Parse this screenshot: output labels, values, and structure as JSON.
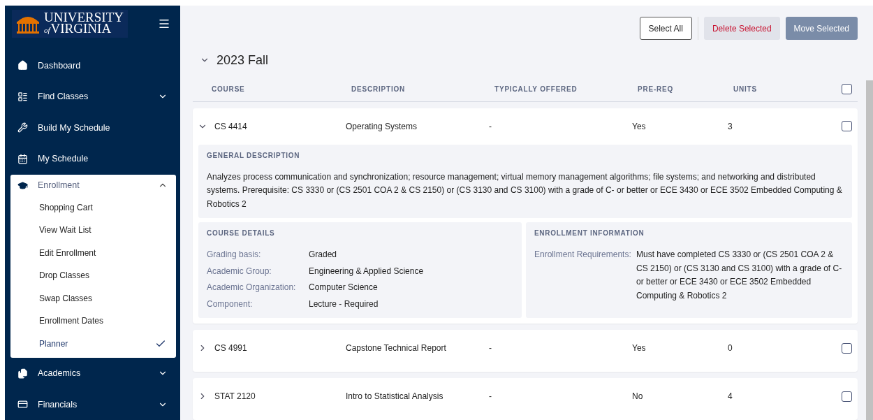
{
  "sidebar": {
    "logo": {
      "line_1": "UNIVERSITY",
      "line_2": "VIRGINIA",
      "of": "of"
    },
    "items": [
      {
        "label": "Dashboard"
      },
      {
        "label": "Find Classes",
        "expanded": false
      },
      {
        "label": "Build My Schedule"
      },
      {
        "label": "My Schedule"
      },
      {
        "label": "Enrollment",
        "expanded": true,
        "children": [
          {
            "label": "Shopping Cart",
            "selected": false
          },
          {
            "label": "View Wait List",
            "selected": false
          },
          {
            "label": "Edit Enrollment",
            "selected": false
          },
          {
            "label": "Drop Classes",
            "selected": false
          },
          {
            "label": "Swap Classes",
            "selected": false
          },
          {
            "label": "Enrollment Dates",
            "selected": false
          },
          {
            "label": "Planner",
            "selected": true
          }
        ]
      },
      {
        "label": "Academics",
        "expanded": false
      },
      {
        "label": "Financials",
        "expanded": false
      }
    ]
  },
  "toolbar": {
    "select_all": "Select All",
    "delete": "Delete Selected",
    "move": "Move Selected"
  },
  "term": {
    "title": "2023 Fall",
    "expanded": true,
    "all_checked": false
  },
  "columns": [
    "COURSE",
    "DESCRIPTION",
    "TYPICALLY OFFERED",
    "PRE-REQ",
    "UNITS"
  ],
  "courses": [
    {
      "course": "CS 4414",
      "description": "Operating Systems",
      "offered": "-",
      "prereq": "Yes",
      "units": "3",
      "expanded": true,
      "checked": false,
      "details": {
        "general_title": "GENERAL DESCRIPTION",
        "general_text": "Analyzes process communication and synchronization; resource management; virtual memory management algorithms; file systems; and networking and distributed systems. Prerequisite: CS 3330 or (CS 2501 COA 2 & CS 2150) or (CS 3130 and CS 3100) with a grade of C- or better or ECE 3430 or ECE 3502 Embedded Computing & Robotics 2",
        "course_details_title": "COURSE DETAILS",
        "course_details": [
          {
            "label": "Grading basis:",
            "value": "Graded"
          },
          {
            "label": "Academic Group:",
            "value": "Engineering & Applied Science"
          },
          {
            "label": "Academic Organization:",
            "value": "Computer Science"
          },
          {
            "label": "Component:",
            "value": "Lecture - Required"
          }
        ],
        "enrollment_title": "ENROLLMENT INFORMATION",
        "enrollment": [
          {
            "label": "Enrollment Requirements:",
            "value": "Must have completed CS 3330 or (CS 2501 COA 2 & CS 2150) or (CS 3130 and CS 3100) with a grade of C- or better or ECE 3430 or ECE 3502 Embedded Computing & Robotics 2"
          }
        ]
      }
    },
    {
      "course": "CS 4991",
      "description": "Capstone Technical Report",
      "offered": "-",
      "prereq": "Yes",
      "units": "0",
      "expanded": false,
      "checked": false
    },
    {
      "course": "STAT 2120",
      "description": "Intro to Statistical Analysis",
      "offered": "-",
      "prereq": "No",
      "units": "4",
      "expanded": false,
      "checked": false
    }
  ]
}
